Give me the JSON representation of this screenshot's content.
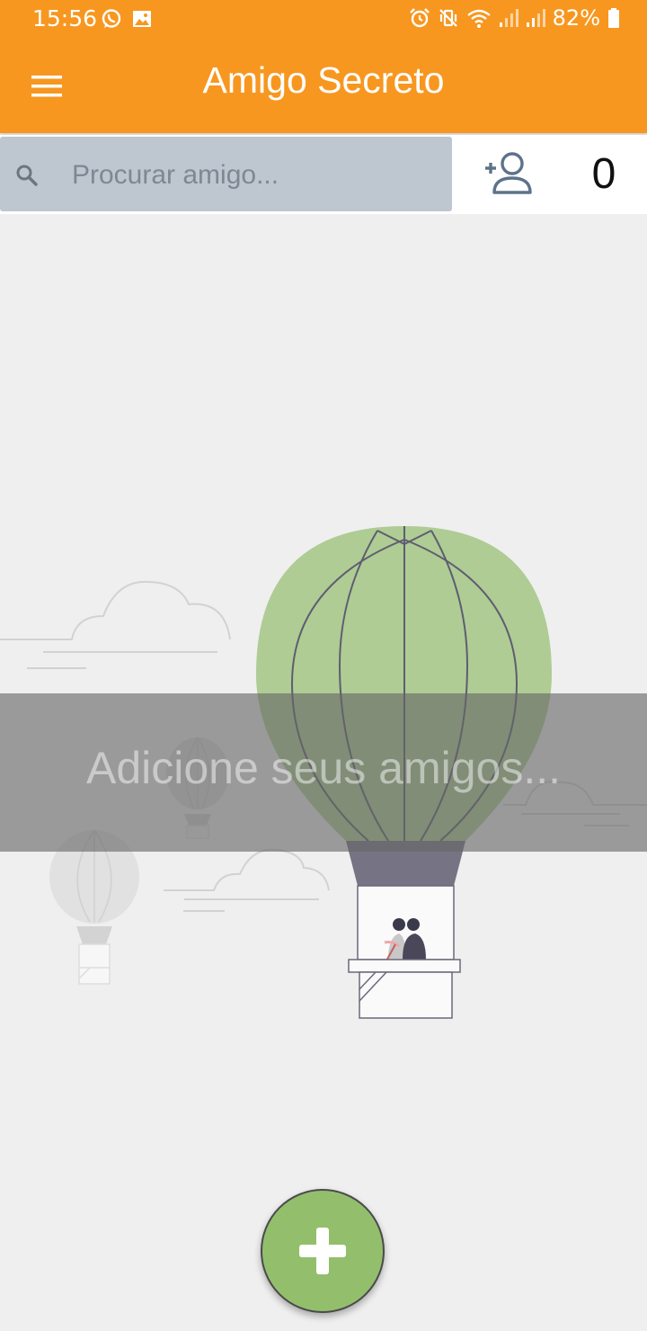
{
  "status_bar": {
    "time": "15:56",
    "battery": "82%",
    "left_icons": [
      "whatsapp-icon",
      "image-icon"
    ],
    "right_icons": [
      "alarm-icon",
      "vibrate-icon",
      "wifi-icon",
      "signal-icon",
      "signal-icon",
      "battery-icon"
    ]
  },
  "app_bar": {
    "title": "Amigo Secreto",
    "menu_icon": "menu-icon",
    "color": "#f79720"
  },
  "search": {
    "placeholder": "Procurar amigo...",
    "value": "",
    "icon": "search-icon"
  },
  "friends": {
    "add_icon": "add-person-icon",
    "count": "0"
  },
  "empty_state": {
    "message": "Adicione seus amigos..."
  },
  "fab": {
    "icon": "plus-icon",
    "color": "#93bf6c"
  }
}
